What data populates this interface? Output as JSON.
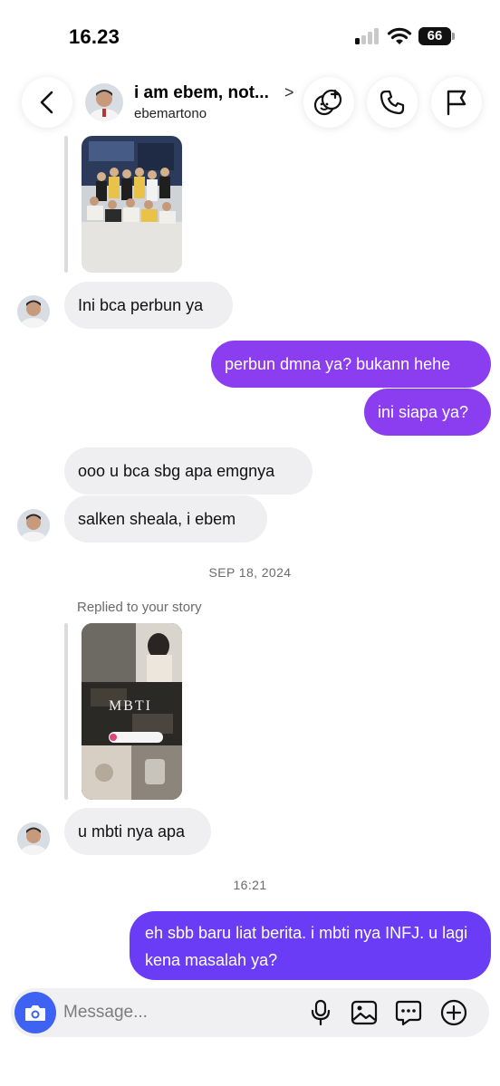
{
  "status_bar": {
    "time": "16.23",
    "battery": "66"
  },
  "header": {
    "name": "i am ebem, not...",
    "chevron": ">",
    "username": "ebemartono"
  },
  "messages": {
    "m1": "Ini bca perbun ya",
    "m2": "perbun dmna ya? bukann hehe",
    "m3": "ini siapa ya?",
    "m4": "ooo u bca sbg apa emgnya",
    "m5": "salken sheala, i ebem",
    "date1": "SEP 18, 2024",
    "replied": "Replied to your story",
    "story_title": "MBTI",
    "m6": "u mbti nya apa",
    "time2": "16:21",
    "m7": "eh sbb baru liat berita. i mbti nya INFJ. u lagi kena masalah ya?"
  },
  "composer": {
    "placeholder": "Message..."
  },
  "colors": {
    "outgoing_purple": "#8a3ef0",
    "outgoing_blue": "#6a3cf5",
    "incoming": "#efeff1",
    "camera": "#3e63f3"
  },
  "icons": [
    "back-icon",
    "effects-icon",
    "phone-icon",
    "flag-icon",
    "camera-icon",
    "microphone-icon",
    "gallery-icon",
    "sticker-icon",
    "plus-icon"
  ]
}
